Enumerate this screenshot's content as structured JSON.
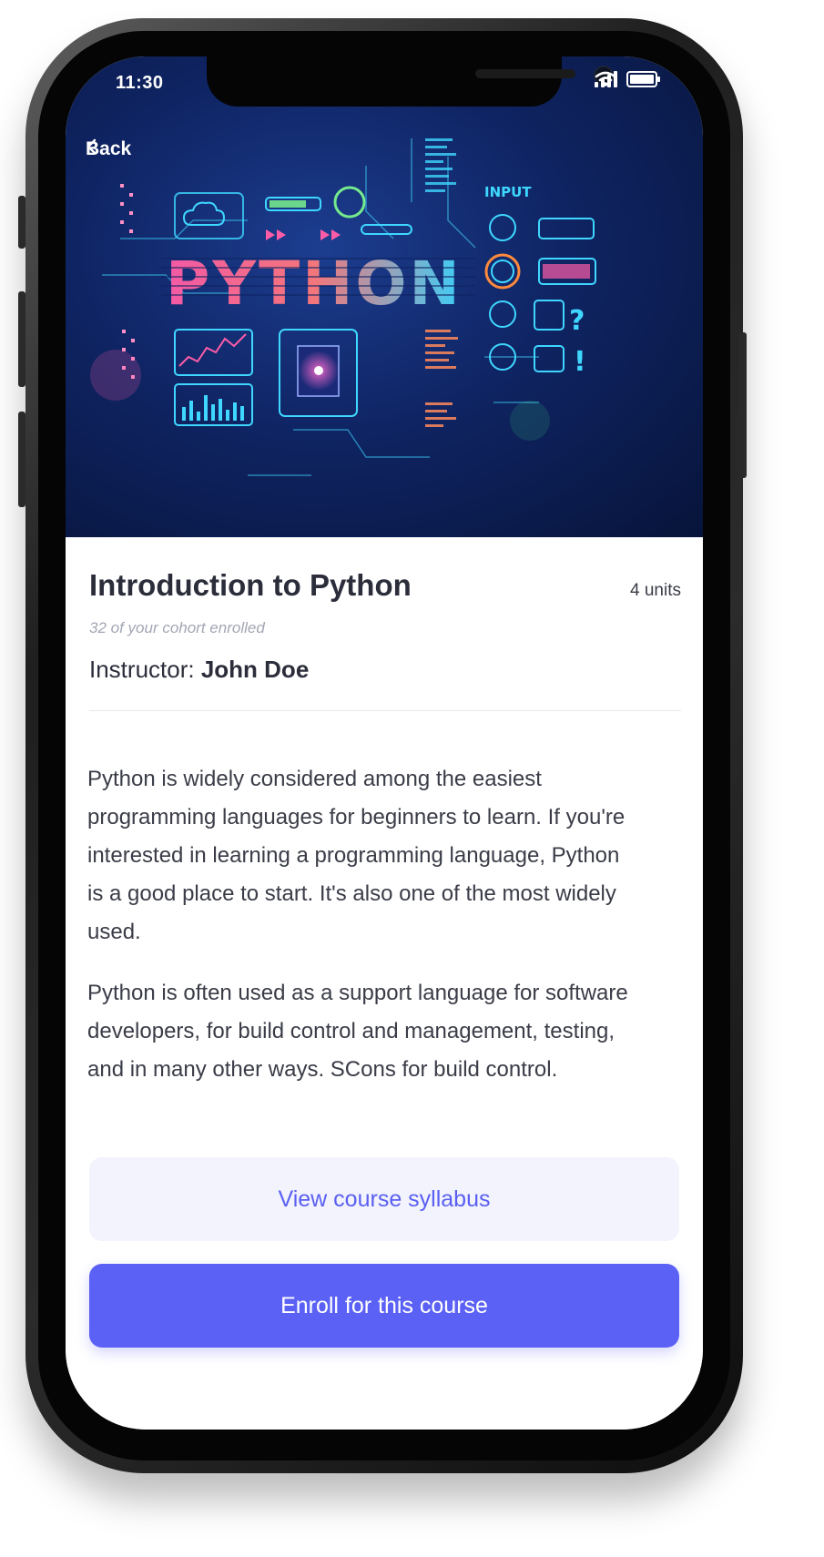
{
  "status_bar": {
    "time": "11:30",
    "icons": [
      "signal-icon",
      "wifi-icon",
      "battery-icon"
    ]
  },
  "nav": {
    "back_label": "Back",
    "back_icon": "chevron-left-icon"
  },
  "hero": {
    "banner_word": "PYTHON",
    "banner_caption": "INPUT",
    "colors": {
      "background": "#0f2463",
      "accent_pink": "#ff3b8f",
      "accent_cyan": "#3fd7ff"
    }
  },
  "course": {
    "title": "Introduction to Python",
    "units": "4 units",
    "cohort_note": "32 of your cohort enrolled",
    "instructor_label": "Instructor:",
    "instructor_name": "John Doe",
    "description": [
      "Python is widely considered among the easiest programming languages for beginners to learn. If you're interested in learning a programming language, Python is a good place to start. It's also one of the most widely used.",
      "Python is often used as a support language for software developers, for build control and management, testing, and in many other ways. SCons for build control."
    ]
  },
  "actions": {
    "syllabus_label": "View course syllabus",
    "enroll_label": "Enroll for this course"
  },
  "theme": {
    "primary": "#5b61f4",
    "secondary_bg": "#f2f3fc",
    "text_dark": "#2b2d3a",
    "text_muted": "#a3a6b4"
  }
}
